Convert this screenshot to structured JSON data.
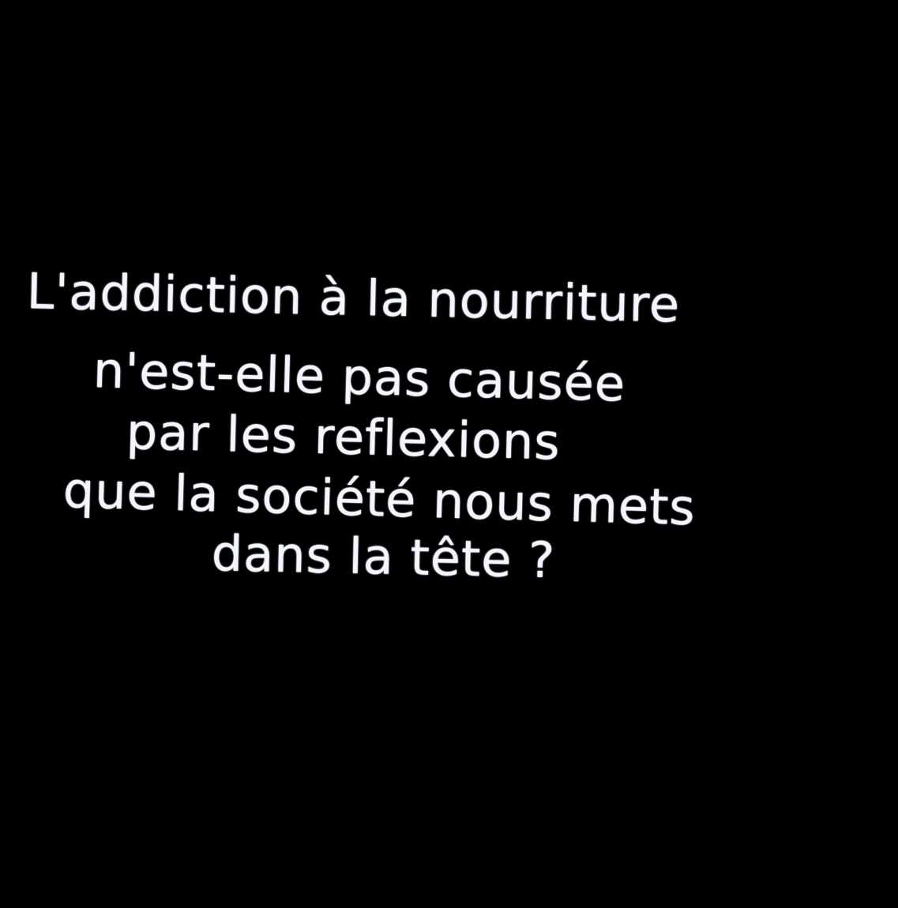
{
  "background_color": "#000000",
  "text_color": "#f4f6fb",
  "quote": {
    "lines": [
      "L'addiction à la nourriture",
      "n'est-elle pas causée",
      "par les reflexions",
      "que la société nous mets",
      "dans la tête ?"
    ]
  }
}
